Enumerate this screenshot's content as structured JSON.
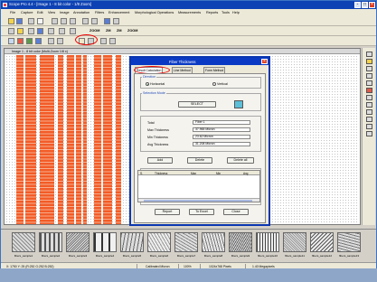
{
  "window": {
    "title": "Scope Pro 4.4 - [Image 1 - 8 bit color - 1/8 Zoom]"
  },
  "menu": {
    "items": [
      "File",
      "Capture",
      "Edit",
      "View",
      "Image",
      "Annotation",
      "Filters",
      "Enhancement",
      "Morphological Operations",
      "Measurements",
      "Reports",
      "Tools",
      "Help"
    ]
  },
  "toolbar2": {
    "zoom_labels": [
      "ZOOM",
      "ZM",
      "ZM",
      "ZOOM"
    ]
  },
  "document": {
    "title": "Image 1 - 8 bit color (Multi-Zoom 1/8 x)"
  },
  "dialog": {
    "title": "Fiber Thickness",
    "tabs": [
      "Result Calculation",
      "Line Method",
      "Form Method"
    ],
    "direction_group_label": "Direction",
    "radio_horizontal": "Horizontal",
    "radio_vertical": "Vertical",
    "selection_label": "Selection Mode",
    "select_button": "SELECT",
    "fields": [
      {
        "label": "Total",
        "value": "Fiber 1"
      },
      {
        "label": "Max Thickness",
        "value": "37.965 Micron"
      },
      {
        "label": "Min Thickness",
        "value": "23.62 Micron"
      },
      {
        "label": "Avg Thickness",
        "value": "31.208 Micron"
      }
    ],
    "action_buttons": [
      "Add",
      "Delete",
      "Delete all"
    ],
    "list_headers": [
      "S.",
      "Thickness",
      "Max",
      "Min",
      "Avg"
    ],
    "bottom_buttons": [
      "Report",
      "To Excel",
      "Close"
    ]
  },
  "thumbnails": [
    {
      "caption": "fibers_sample1"
    },
    {
      "caption": "fibers_sample2"
    },
    {
      "caption": "fibers_sample3"
    },
    {
      "caption": "fibers_sample4"
    },
    {
      "caption": "fibers_sample5"
    },
    {
      "caption": "fibers_sample6"
    },
    {
      "caption": "fibers_sample7"
    },
    {
      "caption": "fibers_sample8"
    },
    {
      "caption": "fibers_sample9"
    },
    {
      "caption": "fibers_sample10"
    },
    {
      "caption": "fibers_sample11"
    },
    {
      "caption": "fibers_sample12"
    },
    {
      "caption": "fibers_sample13"
    }
  ],
  "status": {
    "coords": "X: 1750 Y: 25 (R:252 G:252 B:252)",
    "calibration": "Calibrated Micron",
    "zoom": "100%",
    "size": "1024x768 Pixels",
    "info": "1.40 Megapixels"
  },
  "colors": {
    "titlebar": "#0d42b4",
    "fiber": "#f25c28",
    "swatch": "#5cbfd8",
    "highlight_ring": "#ee0000"
  }
}
